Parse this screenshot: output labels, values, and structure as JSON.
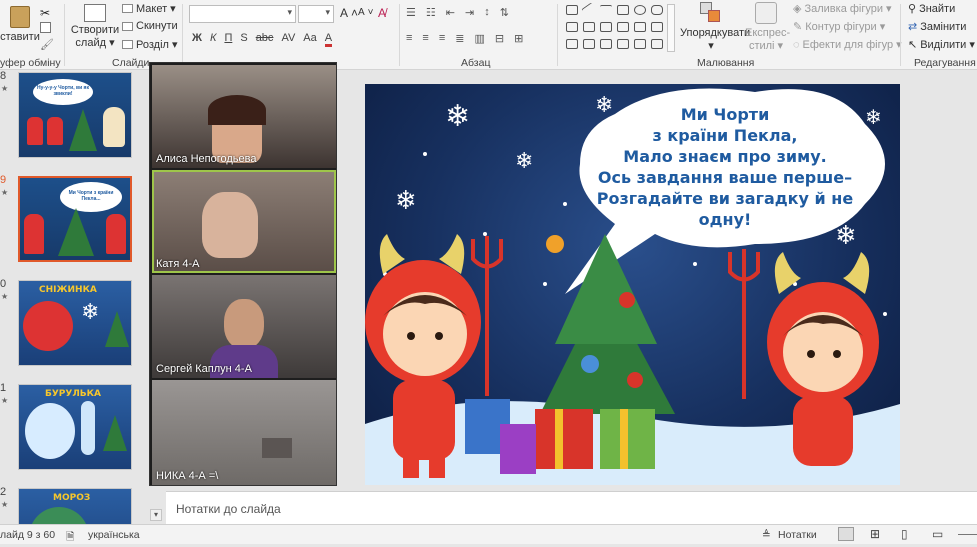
{
  "ribbon": {
    "clipboard": {
      "paste_label": "ставити",
      "group_label": "уфер обміну"
    },
    "slides": {
      "new_slide_label_1": "Створити",
      "new_slide_label_2": "слайд",
      "layout_label": "Макет",
      "reset_label": "Скинути",
      "section_label": "Розділ",
      "group_label": "Слайди"
    },
    "font": {
      "bold": "Ж",
      "italic": "К",
      "underline": "П",
      "shadow": "S",
      "strike": "abc",
      "spacing": "AV",
      "case": "Aa",
      "grow": "A",
      "shrink": "A"
    },
    "paragraph": {
      "group_label": "Абзац"
    },
    "drawing": {
      "arrange_label": "Упорядкувати",
      "styles_label_1": "Експрес-",
      "styles_label_2": "стилі",
      "fill_label": "Заливка фігури",
      "outline_label": "Контур фігури",
      "effects_label": "Ефекти для фігур",
      "group_label": "Малювання"
    },
    "editing": {
      "find_label": "Знайти",
      "replace_label": "Замінити",
      "select_label": "Виділити",
      "group_label": "Редагування"
    }
  },
  "thumbnails": [
    {
      "number": "8",
      "title": "Ну-у-у Чорти, ви як звикли...",
      "selected": false
    },
    {
      "number": "9",
      "title": "Ми Чорти з країни Пекла",
      "selected": true
    },
    {
      "number": "0",
      "title": "СНІЖИНКА",
      "selected": false
    },
    {
      "number": "1",
      "title": "БУРУЛЬКА",
      "selected": false
    },
    {
      "number": "2",
      "title": "МОРОЗ",
      "selected": false
    }
  ],
  "thumb_texts": {
    "t8": "Ну-у-у-у Чорти, ви як звикли!",
    "t9": "Ми Чорти з країни Пекла...",
    "t10_title": "СНІЖИНКА",
    "t11_title": "БУРУЛЬКА",
    "t12_title": "МОРОЗ"
  },
  "participants": [
    {
      "name": "Алиса Непогодьева",
      "active": false
    },
    {
      "name": "Катя 4-А",
      "active": true
    },
    {
      "name": "Сергей Каплун 4-А",
      "active": false
    },
    {
      "name": "НИКА 4-А =\\",
      "active": false
    }
  ],
  "slide": {
    "lines": [
      "Ми Чорти",
      "з країни Пекла,",
      "Мало знаєм про зиму.",
      "Ось завдання ваше перше–",
      "Розгадайте ви загадку й не",
      "одну!"
    ]
  },
  "notes_placeholder": "Нотатки до слайда",
  "status": {
    "slide_counter": "лайд 9 з 60",
    "language": "українська",
    "notes_button": "Нотатки"
  },
  "colors": {
    "accent_selected": "#e0592a",
    "active_speaker": "#9ec54a",
    "bubble_text": "#1f5ba0"
  }
}
